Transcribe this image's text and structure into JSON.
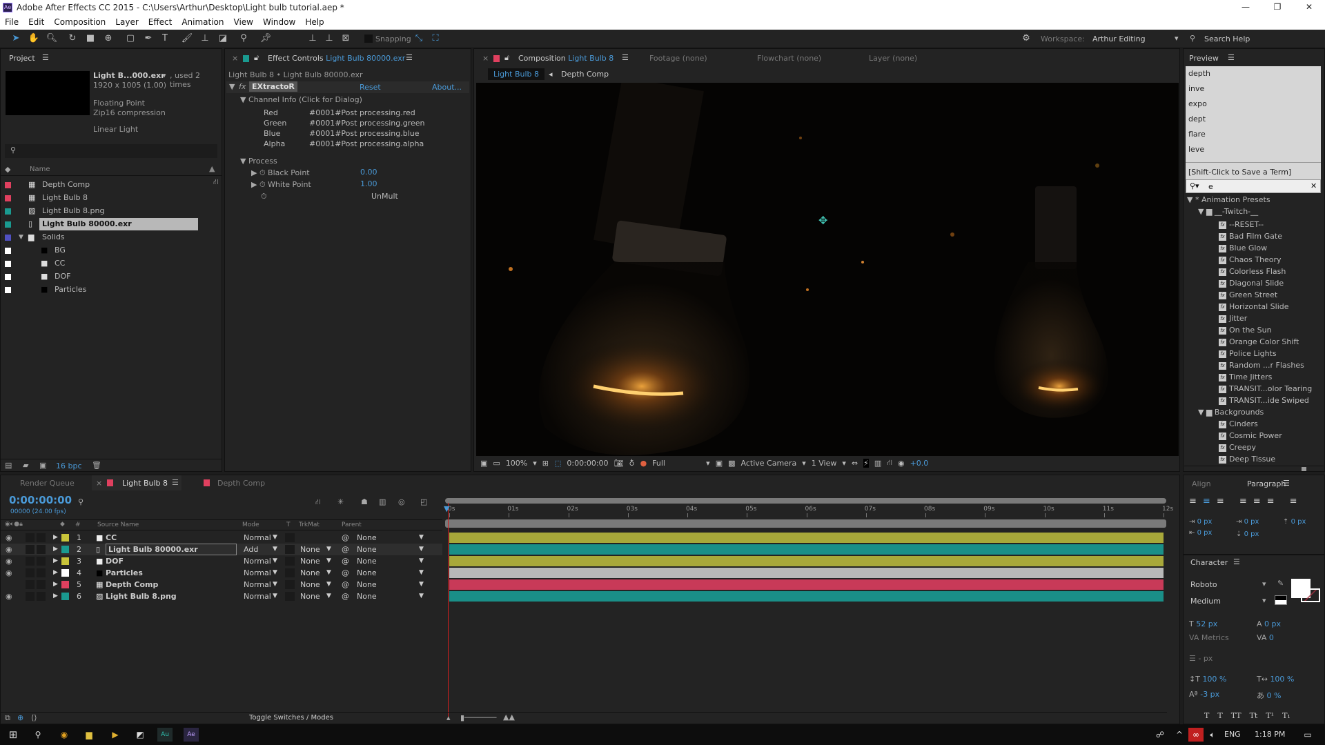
{
  "window": {
    "app_badge": "Ae",
    "title": "Adobe After Effects CC 2015 - C:\\Users\\Arthur\\Desktop\\Light bulb tutorial.aep *",
    "minimize": "—",
    "maximize": "❐",
    "close": "✕"
  },
  "menu": [
    "File",
    "Edit",
    "Composition",
    "Layer",
    "Effect",
    "Animation",
    "View",
    "Window",
    "Help"
  ],
  "toolbar": {
    "snapping": "Snapping",
    "workspace_label": "Workspace:",
    "workspace": "Arthur Editing",
    "search_help": "Search Help"
  },
  "project": {
    "tab": "Project",
    "item_name": "Light B...000.exr",
    "used": ", used 2 times",
    "dims": "1920 x 1005 (1.00)",
    "depth": "Floating Point",
    "compression": "Zip16 compression",
    "color": "Linear Light",
    "col_name": "Name",
    "bpc": "16 bpc",
    "items": [
      {
        "name": "Depth Comp",
        "color": "#e0405f",
        "type": "comp",
        "indent": 0
      },
      {
        "name": "Light Bulb 8",
        "color": "#e0405f",
        "type": "comp",
        "indent": 0
      },
      {
        "name": "Light Bulb 8.png",
        "color": "#1a9a90",
        "type": "image",
        "indent": 0
      },
      {
        "name": "Light Bulb 80000.exr",
        "color": "#1a9a90",
        "type": "footage",
        "indent": 0,
        "selected": true
      },
      {
        "name": "Solids",
        "color": "#5050c0",
        "type": "folder",
        "indent": 0
      },
      {
        "name": "BG",
        "color": "#ffffff",
        "type": "solid-black",
        "indent": 1
      },
      {
        "name": "CC",
        "color": "#ffffff",
        "type": "solid-white",
        "indent": 1
      },
      {
        "name": "DOF",
        "color": "#ffffff",
        "type": "solid-white",
        "indent": 1
      },
      {
        "name": "Particles",
        "color": "#ffffff",
        "type": "solid-black",
        "indent": 1
      }
    ]
  },
  "effect_controls": {
    "tab": "Effect Controls",
    "tab_file": "Light Bulb 80000.exr",
    "breadcrumb": "Light Bulb 8 • Light Bulb 80000.exr",
    "effect": "EXtractoR",
    "reset": "Reset",
    "about": "About...",
    "channel_info": "Channel Info (Click for Dialog)",
    "channels": [
      {
        "k": "Red",
        "v": "#0001#Post processing.red"
      },
      {
        "k": "Green",
        "v": "#0001#Post processing.green"
      },
      {
        "k": "Blue",
        "v": "#0001#Post processing.blue"
      },
      {
        "k": "Alpha",
        "v": "#0001#Post processing.alpha"
      }
    ],
    "process": "Process",
    "black_point_label": "Black Point",
    "black_point": "0.00",
    "white_point_label": "White Point",
    "white_point": "1.00",
    "unmult": "UnMult"
  },
  "composition": {
    "tab": "Composition",
    "tab_comp": "Light Bulb 8",
    "footage": "Footage (none)",
    "flowchart": "Flowchart (none)",
    "layer": "Layer (none)",
    "crumb_active": "Light Bulb 8",
    "crumb_next": "Depth Comp",
    "footer": {
      "zoom": "100%",
      "time": "0:00:00:00",
      "resolution": "Full",
      "camera": "Active Camera",
      "views": "1 View",
      "exposure": "+0.0"
    }
  },
  "preview": {
    "tab": "Preview",
    "history": [
      "depth",
      "inve",
      "expo",
      "dept",
      "flare",
      "leve"
    ],
    "save_hint": "[Shift-Click to Save a Term]",
    "search_value": "e",
    "tree_root": "Animation Presets",
    "folder1": "__-Twitch-__",
    "twitch": [
      "--RESET--",
      "Bad Film Gate",
      "Blue Glow",
      "Chaos Theory",
      "Colorless Flash",
      "Diagonal Slide",
      "Green Street",
      "Horizontal Slide",
      "Jitter",
      "On the Sun",
      "Orange Color Shift",
      "Police Lights",
      "Random ...r Flashes",
      "Time Jitters",
      "TRANSIT...olor Tearing",
      "TRANSIT...ide Swiped"
    ],
    "folder2": "Backgrounds",
    "backgrounds": [
      "Cinders",
      "Cosmic Power",
      "Creepy",
      "Deep Tissue"
    ]
  },
  "timeline": {
    "tabs": {
      "render": "Render Queue",
      "active": "Light Bulb 8",
      "other": "Depth Comp"
    },
    "timecode": "0:00:00:00",
    "frames": "00000 (24.00 fps)",
    "headers": {
      "num": "#",
      "source": "Source Name",
      "mode": "Mode",
      "t": "T",
      "trkmat": "TrkMat",
      "parent": "Parent"
    },
    "ruler": [
      "0s",
      "01s",
      "02s",
      "03s",
      "04s",
      "05s",
      "06s",
      "07s",
      "08s",
      "09s",
      "10s",
      "11s",
      "12s"
    ],
    "layers": [
      {
        "num": "1",
        "name": "CC",
        "label": "#c8c43a",
        "mode": "Normal",
        "trkmat": "",
        "parent": "None",
        "bar": "#a8a83a",
        "icon": "solid-white",
        "visible": true
      },
      {
        "num": "2",
        "name": "Light Bulb 80000.exr",
        "label": "#1a9a90",
        "mode": "Add",
        "trkmat": "None",
        "parent": "None",
        "bar": "#1a8f88",
        "icon": "footage",
        "visible": true,
        "selected": true
      },
      {
        "num": "3",
        "name": "DOF",
        "label": "#c8c43a",
        "mode": "Normal",
        "trkmat": "None",
        "parent": "None",
        "bar": "#a8a83a",
        "icon": "solid-white",
        "visible": true
      },
      {
        "num": "4",
        "name": "Particles",
        "label": "#ffffff",
        "mode": "Normal",
        "trkmat": "None",
        "parent": "None",
        "bar": "#b8b8b8",
        "icon": "solid-black",
        "visible": true
      },
      {
        "num": "5",
        "name": "Depth Comp",
        "label": "#e0405f",
        "mode": "Normal",
        "trkmat": "None",
        "parent": "None",
        "bar": "#c83a58",
        "icon": "comp",
        "visible": false
      },
      {
        "num": "6",
        "name": "Light Bulb 8.png",
        "label": "#1a9a90",
        "mode": "Normal",
        "trkmat": "None",
        "parent": "None",
        "bar": "#1a8f88",
        "icon": "image",
        "visible": true
      }
    ],
    "toggle": "Toggle Switches / Modes"
  },
  "paragraph": {
    "tab_align": "Align",
    "tab_paragraph": "Paragraph",
    "indents": [
      "0 px",
      "0 px",
      "0 px",
      "0 px",
      "0 px"
    ]
  },
  "character": {
    "tab": "Character",
    "font": "Roboto",
    "style": "Medium",
    "size": "52 px",
    "leading": "0 px",
    "kerning": "Metrics",
    "tracking": "0",
    "stroke": "- px",
    "vscale": "100 %",
    "hscale": "100 %",
    "baseline": "-3 px",
    "tsume": "0 %",
    "styles": [
      "T",
      "T",
      "TT",
      "Tt",
      "T¹",
      "T₁"
    ]
  },
  "taskbar": {
    "lang": "ENG",
    "time": "1:18 PM"
  },
  "colors": {
    "accent": "#4a9ad8",
    "panel": "#232323",
    "selected": "#b8b8b8",
    "playhead": "#d02020"
  }
}
